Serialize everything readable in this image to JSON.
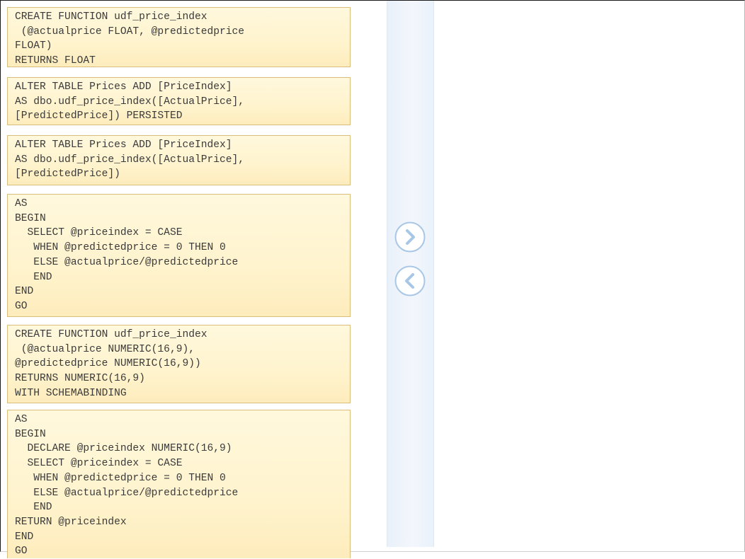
{
  "source_blocks": [
    {
      "lines": [
        "CREATE FUNCTION udf_price_index",
        " (@actualprice FLOAT, @predictedprice",
        "FLOAT)",
        "RETURNS FLOAT"
      ]
    },
    {
      "lines": [
        "ALTER TABLE Prices ADD [PriceIndex]",
        "AS dbo.udf_price_index([ActualPrice],",
        "[PredictedPrice]) PERSISTED"
      ]
    },
    {
      "lines": [
        "ALTER TABLE Prices ADD [PriceIndex]",
        "AS dbo.udf_price_index([ActualPrice],",
        "[PredictedPrice])"
      ]
    },
    {
      "lines": [
        "AS",
        "BEGIN",
        "  SELECT @priceindex = CASE",
        "   WHEN @predictedprice = 0 THEN 0",
        "   ELSE @actualprice/@predictedprice",
        "   END",
        "END",
        "GO"
      ]
    },
    {
      "lines": [
        "CREATE FUNCTION udf_price_index",
        " (@actualprice NUMERIC(16,9),",
        "@predictedprice NUMERIC(16,9))",
        "RETURNS NUMERIC(16,9)",
        "WITH SCHEMABINDING"
      ]
    },
    {
      "lines": [
        "AS",
        "BEGIN",
        "  DECLARE @priceindex NUMERIC(16,9)",
        "  SELECT @priceindex = CASE",
        "   WHEN @predictedprice = 0 THEN 0",
        "   ELSE @actualprice/@predictedprice",
        "   END",
        "RETURN @priceindex",
        "END",
        "GO"
      ]
    }
  ],
  "controls": {
    "move_right_icon": "chevron-right-circle",
    "move_left_icon": "chevron-left-circle",
    "arrow_color": "#a8c7e6"
  },
  "colors": {
    "block_background": "#fff3cc",
    "block_border": "#d9bd7a",
    "divider_background": "#edf3fb",
    "code_text": "#3a3a3a"
  },
  "target_area": {
    "items": []
  }
}
